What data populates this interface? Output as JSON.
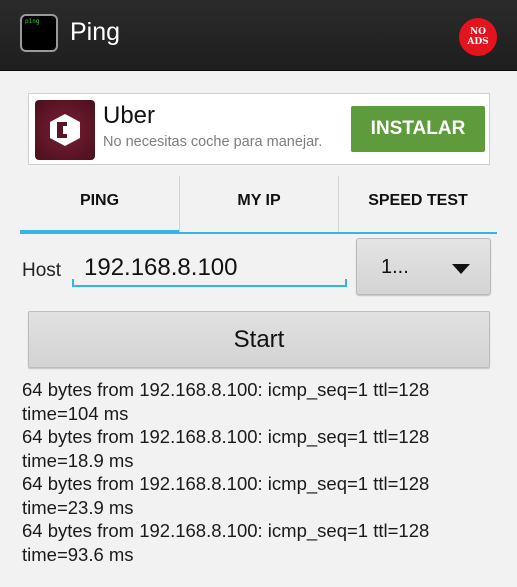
{
  "app": {
    "title": "Ping",
    "icon_text": "ping",
    "noads_line1": "NO",
    "noads_line2": "ADS"
  },
  "ad": {
    "name": "Uber",
    "subtitle": "No necesitas coche para manejar.",
    "cta": "INSTALAR"
  },
  "tabs": [
    {
      "label": "PING",
      "selected": true
    },
    {
      "label": "MY IP",
      "selected": false
    },
    {
      "label": "SPEED TEST",
      "selected": false
    }
  ],
  "form": {
    "host_label": "Host",
    "host_value": "192.168.8.100",
    "count_value": "1...",
    "start_label": "Start"
  },
  "output": [
    "64 bytes from 192.168.8.100: icmp_seq=1 ttl=128",
    "time=104 ms",
    "64 bytes from 192.168.8.100: icmp_seq=1 ttl=128",
    "time=18.9 ms",
    "64 bytes from 192.168.8.100: icmp_seq=1 ttl=128",
    "time=23.9 ms",
    "64 bytes from 192.168.8.100: icmp_seq=1 ttl=128",
    "time=93.6 ms"
  ],
  "colors": {
    "accent": "#33b5e5",
    "ad_button": "#5e9b3c",
    "noads": "#e3141e",
    "appbar": "#222222"
  }
}
